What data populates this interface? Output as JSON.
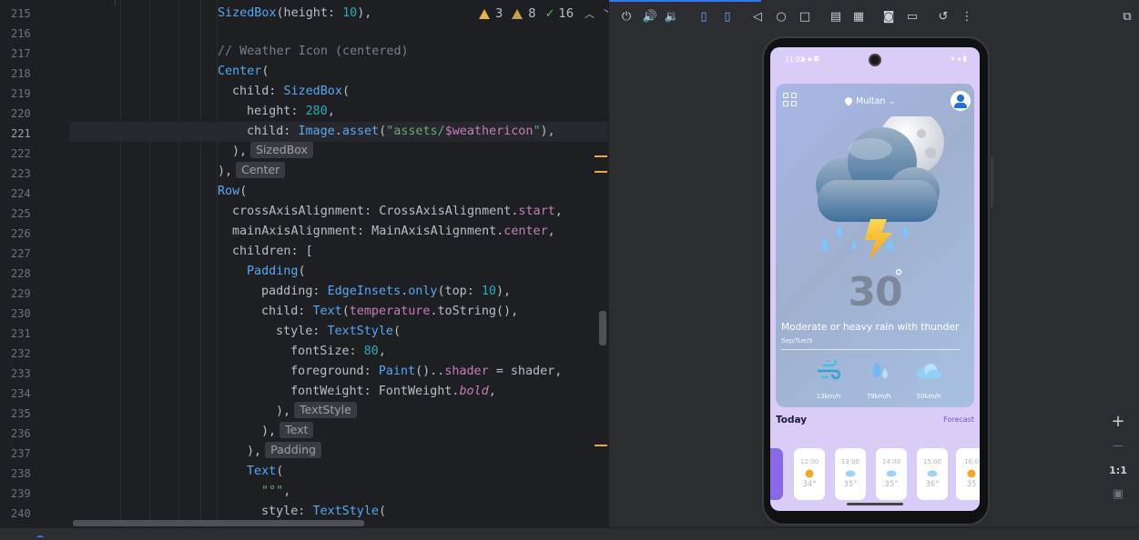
{
  "editor": {
    "lines": [
      {
        "num": "215"
      },
      {
        "num": "216"
      },
      {
        "num": "217"
      },
      {
        "num": "218"
      },
      {
        "num": "219"
      },
      {
        "num": "220"
      },
      {
        "num": "221"
      },
      {
        "num": "222"
      },
      {
        "num": "223"
      },
      {
        "num": "224"
      },
      {
        "num": "225"
      },
      {
        "num": "226"
      },
      {
        "num": "227"
      },
      {
        "num": "228"
      },
      {
        "num": "229"
      },
      {
        "num": "230"
      },
      {
        "num": "231"
      },
      {
        "num": "232"
      },
      {
        "num": "233"
      },
      {
        "num": "234"
      },
      {
        "num": "235"
      },
      {
        "num": "236"
      },
      {
        "num": "237"
      },
      {
        "num": "238"
      },
      {
        "num": "239"
      },
      {
        "num": "240"
      }
    ],
    "code": {
      "l215_a": "SizedBox",
      "l215_b": "(height: ",
      "l215_c": "10",
      "l215_d": "),",
      "l217": "// Weather Icon (centered)",
      "l218_a": "Center",
      "l218_b": "(",
      "l219_a": "child: ",
      "l219_b": "SizedBox",
      "l219_c": "(",
      "l220_a": "height: ",
      "l220_b": "280",
      "l220_c": ",",
      "l221_a": "child: ",
      "l221_b": "Image",
      "l221_c": ".",
      "l221_d": "asset",
      "l221_e": "(",
      "l221_f": "\"assets/",
      "l221_g": "$weathericon",
      "l221_h": "\"",
      "l221_i": "),",
      "l222_a": "),",
      "l223_a": "),",
      "l224_a": "Row",
      "l224_b": "(",
      "l225_a": "crossAxisAlignment: CrossAxisAlignment.",
      "l225_b": "start",
      "l225_c": ",",
      "l226_a": "mainAxisAlignment: MainAxisAlignment.",
      "l226_b": "center",
      "l226_c": ",",
      "l227_a": "children: [",
      "l228_a": "Padding",
      "l228_b": "(",
      "l229_a": "padding: ",
      "l229_b": "EdgeInsets",
      "l229_c": ".",
      "l229_d": "only",
      "l229_e": "(top: ",
      "l229_f": "10",
      "l229_g": "),",
      "l230_a": "child: ",
      "l230_b": "Text",
      "l230_c": "(",
      "l230_d": "temperature",
      "l230_e": ".toString(),",
      "l231_a": "style: ",
      "l231_b": "TextStyle",
      "l231_c": "(",
      "l232_a": "fontSize: ",
      "l232_b": "80",
      "l232_c": ",",
      "l233_a": "foreground: ",
      "l233_b": "Paint",
      "l233_c": "()..",
      "l233_d": "shader",
      "l233_e": " = shader,",
      "l234_a": "fontWeight: FontWeight.",
      "l234_b": "bold",
      "l234_c": ",",
      "l235_a": "),",
      "l236_a": "),",
      "l237_a": "),",
      "l238_a": "Text",
      "l238_b": "(",
      "l239_a": "\"°\"",
      "l239_b": ",",
      "l240_a": "style: ",
      "l240_b": "TextStyle",
      "l240_c": "("
    },
    "hints": {
      "sizedbox": "SizedBox",
      "center": "Center",
      "textstyle": "TextStyle",
      "text": "Text",
      "padding": "Padding"
    },
    "inspections": {
      "warnings": "3",
      "weak_warnings": "8",
      "typos": "16"
    }
  },
  "device_toolbar": {
    "buttons": [
      "power-icon",
      "volume-up-icon",
      "volume-down-icon",
      "rotate-left-icon",
      "rotate-right-icon",
      "back-icon",
      "home-icon",
      "overview-icon",
      "fold-icon",
      "snapshot-icon",
      "screenshot-icon",
      "screen-record-icon",
      "reset-icon",
      "more-icon",
      "device-settings-icon"
    ]
  },
  "zoom": {
    "one_to_one": "1:1",
    "zoom_in": "+",
    "zoom_out": "—"
  },
  "phone": {
    "status_time": "11:02",
    "location": "Multan",
    "temperature": "30",
    "degree": "°",
    "condition": "Moderate or heavy rain with thunder",
    "date": "Sep/Tue/9",
    "stats": [
      {
        "value": "13km/h"
      },
      {
        "value": "79km/h"
      },
      {
        "value": "50km/h"
      }
    ],
    "today_label": "Today",
    "forecast_label": "Forecast",
    "hourly": [
      {
        "time": "12:00",
        "temp": "34°"
      },
      {
        "time": "13:00",
        "temp": "35°"
      },
      {
        "time": "14:00",
        "temp": "35°"
      },
      {
        "time": "15:00",
        "temp": "36°"
      },
      {
        "time": "16:0",
        "temp": "35"
      }
    ]
  },
  "colors": {
    "accent": "#3574f0",
    "warning": "#e8b23d",
    "card_purple": "#8b68e8"
  }
}
